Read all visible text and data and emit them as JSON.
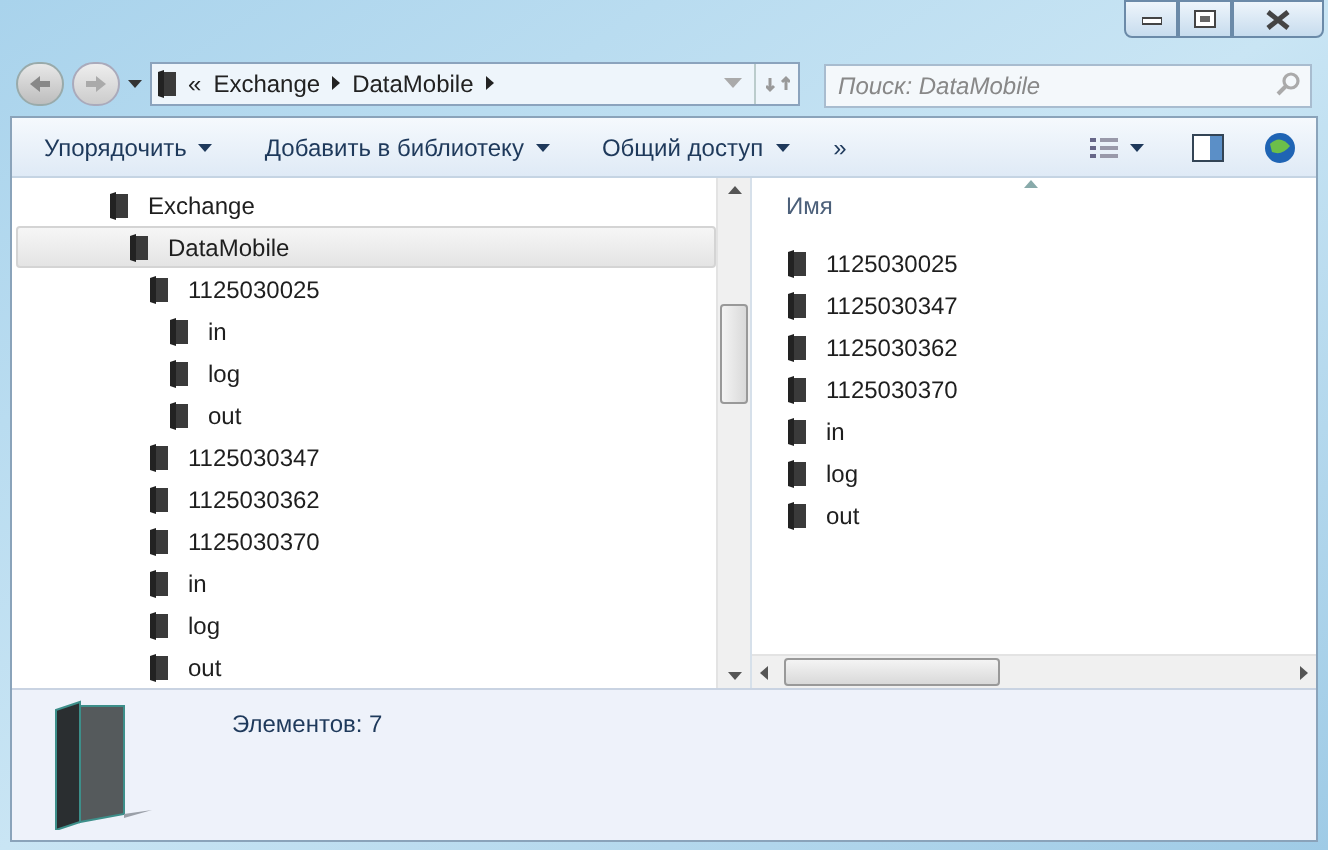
{
  "window": {
    "buttons": [
      {
        "kind": "minimize"
      },
      {
        "kind": "maximize"
      },
      {
        "kind": "close"
      }
    ]
  },
  "address_bar": {
    "overflow": "«",
    "segments": [
      "Exchange",
      "DataMobile"
    ]
  },
  "search": {
    "placeholder": "Поиск: DataMobile"
  },
  "toolbar": {
    "items": [
      "Упорядочить",
      "Добавить в библиотеку",
      "Общий доступ"
    ],
    "more": "»"
  },
  "tree": [
    {
      "label": "Exchange",
      "selected": false,
      "children": [
        {
          "label": "DataMobile",
          "selected": true,
          "children": [
            {
              "label": "1125030025",
              "selected": false,
              "children": [
                {
                  "label": "in",
                  "selected": false
                },
                {
                  "label": "log",
                  "selected": false
                },
                {
                  "label": "out",
                  "selected": false
                }
              ]
            },
            {
              "label": "1125030347",
              "selected": false
            },
            {
              "label": "1125030362",
              "selected": false
            },
            {
              "label": "1125030370",
              "selected": false
            },
            {
              "label": "in",
              "selected": false
            },
            {
              "label": "log",
              "selected": false
            },
            {
              "label": "out",
              "selected": false
            }
          ]
        }
      ]
    }
  ],
  "file_list": {
    "column": "Имя",
    "items": [
      "1125030025",
      "1125030347",
      "1125030362",
      "1125030370",
      "in",
      "log",
      "out"
    ]
  },
  "details": {
    "text": "Элементов: 7"
  }
}
